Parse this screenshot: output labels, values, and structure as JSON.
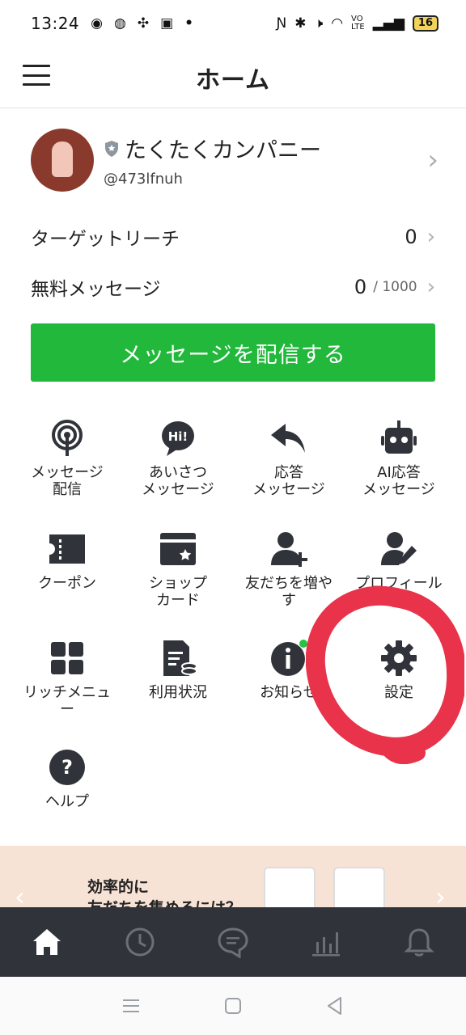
{
  "status_bar": {
    "time": "13:24",
    "notif_icons": [
      "chrome-icon",
      "line-icon",
      "slack-icon",
      "facebook-icon",
      "dot-icon"
    ],
    "battery": "16"
  },
  "header": {
    "title": "ホーム"
  },
  "account": {
    "name": "たくたくカンパニー",
    "id": "@473lfnuh"
  },
  "stats": [
    {
      "label": "ターゲットリーチ",
      "value": "0",
      "sub": ""
    },
    {
      "label": "無料メッセージ",
      "value": "0",
      "sub": "/ 1000"
    }
  ],
  "primary_button": {
    "label": "メッセージを配信する",
    "color": "#21b83b"
  },
  "grid": [
    {
      "line1": "メッセージ",
      "line2": "配信",
      "icon": "broadcast-icon"
    },
    {
      "line1": "あいさつ",
      "line2": "メッセージ",
      "icon": "greeting-icon"
    },
    {
      "line1": "応答",
      "line2": "メッセージ",
      "icon": "reply-icon"
    },
    {
      "line1": "AI応答",
      "line2": "メッセージ",
      "icon": "robot-icon"
    },
    {
      "line1": "クーポン",
      "line2": "",
      "icon": "coupon-icon"
    },
    {
      "line1": "ショップ",
      "line2": "カード",
      "icon": "shopcard-icon"
    },
    {
      "line1": "友だちを増や",
      "line2": "す",
      "icon": "add-friend-icon"
    },
    {
      "line1": "プロフィール",
      "line2": "",
      "icon": "profile-edit-icon"
    },
    {
      "line1": "リッチメニュ",
      "line2": "ー",
      "icon": "rich-menu-icon"
    },
    {
      "line1": "利用状況",
      "line2": "",
      "icon": "usage-icon"
    },
    {
      "line1": "お知らせ",
      "line2": "",
      "icon": "info-icon"
    },
    {
      "line1": "設定",
      "line2": "",
      "icon": "gear-icon"
    },
    {
      "line1": "ヘルプ",
      "line2": "",
      "icon": "help-icon"
    }
  ],
  "banner": {
    "text_line1": "効率的に",
    "text_line2": "友だちを集めるには？",
    "background": "#f7e2d6"
  },
  "tabbar": {
    "background": "#30343a",
    "tabs": [
      "home-icon",
      "clock-icon",
      "chat-icon",
      "chart-icon",
      "bell-icon"
    ]
  }
}
